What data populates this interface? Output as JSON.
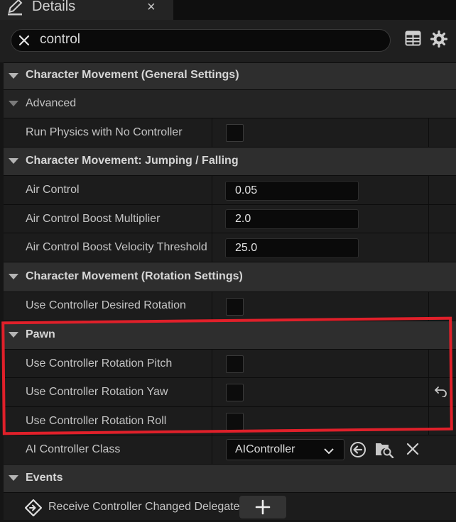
{
  "tab": {
    "title": "Details",
    "close_glyph": "×",
    "icon": "pencil-icon"
  },
  "search": {
    "value": "control",
    "clear_icon": "close-icon"
  },
  "toolbar": {
    "icons": [
      "table-icon",
      "gear-icon"
    ]
  },
  "categories": {
    "general": "Character Movement (General Settings)",
    "advanced": "Advanced",
    "jumping": "Character Movement: Jumping / Falling",
    "rotation": "Character Movement (Rotation Settings)",
    "pawn": "Pawn",
    "events": "Events"
  },
  "properties": {
    "run_physics": {
      "label": "Run Physics with No Controller",
      "checked": false
    },
    "air_control": {
      "label": "Air Control",
      "value": "0.05"
    },
    "air_boost_mult": {
      "label": "Air Control Boost Multiplier",
      "value": "2.0"
    },
    "air_boost_thresh": {
      "label": "Air Control Boost Velocity Threshold",
      "value": "25.0"
    },
    "use_desired_rot": {
      "label": "Use Controller Desired Rotation",
      "checked": false
    },
    "rot_pitch": {
      "label": "Use Controller Rotation Pitch",
      "checked": false
    },
    "rot_yaw": {
      "label": "Use Controller Rotation Yaw",
      "checked": false
    },
    "rot_roll": {
      "label": "Use Controller Rotation Roll",
      "checked": false
    },
    "ai_class": {
      "label": "AI Controller Class",
      "value": "AIController"
    },
    "receive_delegate": {
      "label": "Receive Controller Changed Delegate"
    }
  },
  "colors": {
    "highlight": "#e0202a",
    "background": "#1b1b1b"
  }
}
